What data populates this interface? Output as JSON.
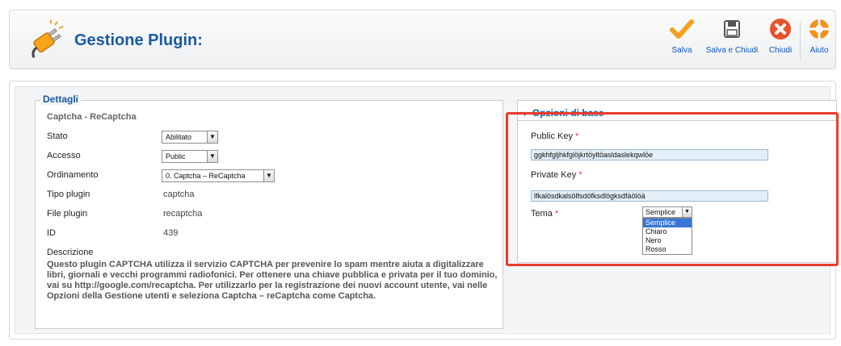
{
  "header": {
    "title": "Gestione Plugin:",
    "buttons": [
      {
        "label": "Salva",
        "icon": "checkmark-icon",
        "color": "#f5a11c"
      },
      {
        "label": "Salva e Chiudi",
        "icon": "save-close-icon",
        "color": "#555555"
      },
      {
        "label": "Chiudi",
        "icon": "close-icon",
        "color": "#e8532c"
      },
      {
        "label": "Aiuto",
        "icon": "help-lifebuoy-icon",
        "color": "#f5901c"
      }
    ]
  },
  "details": {
    "legend": "Dettagli",
    "subtitle": "Captcha - ReCaptcha",
    "rows": {
      "stato": {
        "label": "Stato",
        "value": "Abilitato"
      },
      "accesso": {
        "label": "Accesso",
        "value": "Public"
      },
      "ordinamento": {
        "label": "Ordinamento",
        "value": "0. Captcha – ReCaptcha"
      },
      "tipo": {
        "label": "Tipo plugin",
        "value": "captcha"
      },
      "file": {
        "label": "File plugin",
        "value": "recaptcha"
      },
      "id": {
        "label": "ID",
        "value": "439"
      },
      "descrizione": {
        "label": "Descrizione"
      }
    },
    "description": "Questo plugin CAPTCHA utilizza il servizio CAPTCHA per prevenire lo spam mentre aiuta a digitalizzare libri, giornali e vecchi programmi radiofonici. Per ottenere una chiave pubblica e privata per il tuo dominio, vai su http://google.com/recaptcha. Per utilizzarlo per la registrazione dei nuovi account utente, vai nelle Opzioni della Gestione utenti e seleziona Captcha – reCaptcha come Captcha."
  },
  "options": {
    "header": "Opzioni di base",
    "public_key": {
      "label": "Public Key",
      "value": "ggkhfgljhkfglöjkrtöyltöasldaslekqwlöe"
    },
    "private_key": {
      "label": "Private Key",
      "value": "lfkalösdkalsölfsdöfksdlögksdfàölöà"
    },
    "tema": {
      "label": "Tema",
      "value": "Semplice",
      "options": [
        "Semplice",
        "Chiaro",
        "Nero",
        "Rosso"
      ]
    },
    "required_marker": "*"
  },
  "colors": {
    "accent": "#1a5aa2",
    "highlight": "#ea3b2b"
  }
}
